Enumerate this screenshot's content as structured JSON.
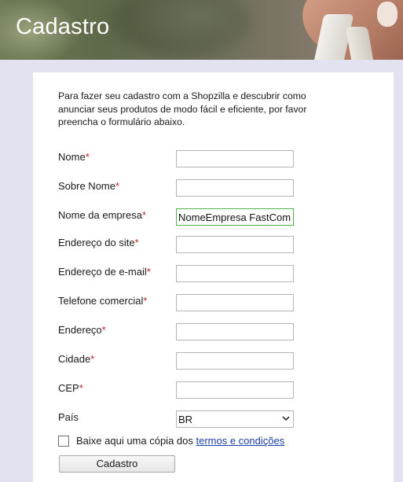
{
  "banner": {
    "title": "Cadastro"
  },
  "intro": "Para fazer seu cadastro com a Shopzilla e descubrir como anunciar seus produtos de modo fácil e eficiente, por favor preencha o formulário abaixo.",
  "required_marker": "*",
  "fields": [
    {
      "label": "Nome",
      "value": ""
    },
    {
      "label": "Sobre Nome",
      "value": ""
    },
    {
      "label": "Nome da empresa",
      "value": "NomeEmpresa FastCom"
    },
    {
      "label": "Endereço do site",
      "value": ""
    },
    {
      "label": "Endereço de e-mail",
      "value": ""
    },
    {
      "label": "Telefone comercial",
      "value": ""
    },
    {
      "label": "Endereço",
      "value": ""
    },
    {
      "label": "Cidade",
      "value": ""
    },
    {
      "label": "CEP",
      "value": ""
    }
  ],
  "country": {
    "label": "País",
    "selected": "BR"
  },
  "terms": {
    "text": "Baixe aqui uma cópia dos ",
    "link": "termos e condições",
    "checked": false
  },
  "submit_label": "Cadastro",
  "colors": {
    "required": "#c1272d",
    "link": "#1a3fa8",
    "focus_border": "#4db34d",
    "page_bg": "#e3e2f0"
  }
}
